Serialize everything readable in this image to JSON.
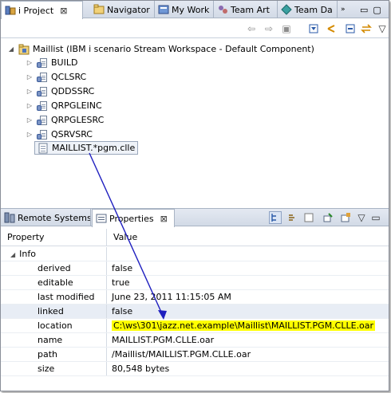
{
  "top_tabs": [
    {
      "label": "i Project",
      "close": "⊠"
    },
    {
      "label": "Navigator"
    },
    {
      "label": "My Work"
    },
    {
      "label": "Team Art"
    },
    {
      "label": "Team Da"
    }
  ],
  "tree": {
    "root": "Maillist (IBM i scenario Stream Workspace - Default Component)",
    "children": [
      "BUILD",
      "QCLSRC",
      "QDDSSRC",
      "QRPGLEINC",
      "QRPGLESRC",
      "QSRVSRC"
    ],
    "selected": "MAILLIST.*pgm.clle"
  },
  "bottom_tabs": [
    {
      "label": "Remote Systems"
    },
    {
      "label": "Properties",
      "close": "⊠"
    }
  ],
  "properties": {
    "col_property": "Property",
    "col_value": "Value",
    "category": "Info",
    "rows": [
      {
        "key": "derived",
        "value": "false"
      },
      {
        "key": "editable",
        "value": "true"
      },
      {
        "key": "last modified",
        "value": "June 23, 2011 11:15:05 AM"
      },
      {
        "key": "linked",
        "value": "false"
      },
      {
        "key": "location",
        "value": "C:\\ws\\301\\jazz.net.example\\Maillist\\MAILLIST.PGM.CLLE.oar"
      },
      {
        "key": "name",
        "value": "MAILLIST.PGM.CLLE.oar"
      },
      {
        "key": "path",
        "value": "/Maillist/MAILLIST.PGM.CLLE.oar"
      },
      {
        "key": "size",
        "value": "80,548  bytes"
      }
    ]
  },
  "colors": {
    "highlight": "#ffff00",
    "arrow": "#1f1fbf"
  }
}
